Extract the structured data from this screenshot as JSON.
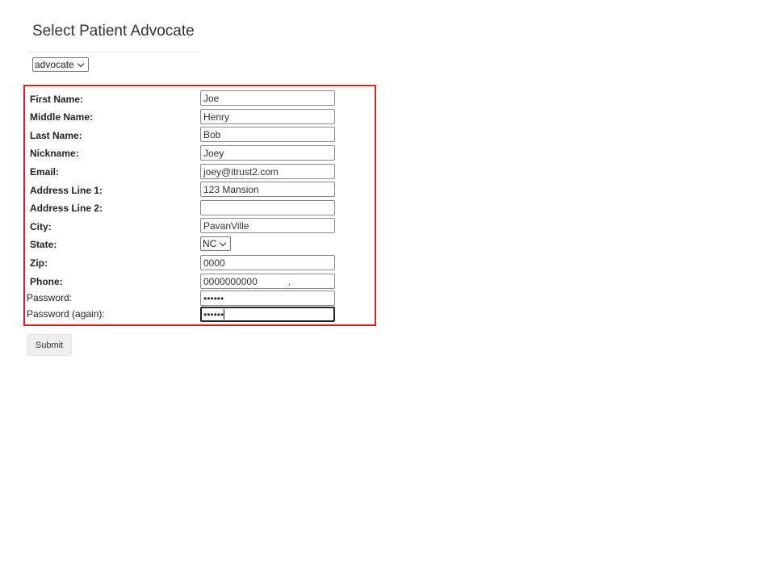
{
  "header": {
    "title": "Select Patient Advocate"
  },
  "advocate_select": {
    "selected": "advocate"
  },
  "form": {
    "first_name": {
      "label": "First Name:",
      "value": "Joe"
    },
    "middle_name": {
      "label": "Middle Name:",
      "value": "Henry"
    },
    "last_name": {
      "label": "Last Name:",
      "value": "Bob"
    },
    "nickname": {
      "label": "Nickname:",
      "value": "Joey"
    },
    "email": {
      "label": "Email:",
      "value": "joey@itrust2.com"
    },
    "address1": {
      "label": "Address Line 1:",
      "value": "123 Mansion"
    },
    "address2": {
      "label": "Address Line 2:",
      "value": ""
    },
    "city": {
      "label": "City:",
      "value": "PavanVille"
    },
    "state": {
      "label": "State:",
      "selected": "NC"
    },
    "zip": {
      "label": "Zip:",
      "value": "0000"
    },
    "phone": {
      "label": "Phone:",
      "value": "0000000000",
      "stray_mark": "."
    },
    "password": {
      "label": "Password:",
      "masked": "••••••"
    },
    "password_again": {
      "label": "Password (again):",
      "masked": "••••••"
    }
  },
  "submit": {
    "label": "Submit"
  },
  "colors": {
    "frame_border": "#e51b24",
    "button_bg": "#eeeeee",
    "field_border": "#8a8a8a"
  }
}
